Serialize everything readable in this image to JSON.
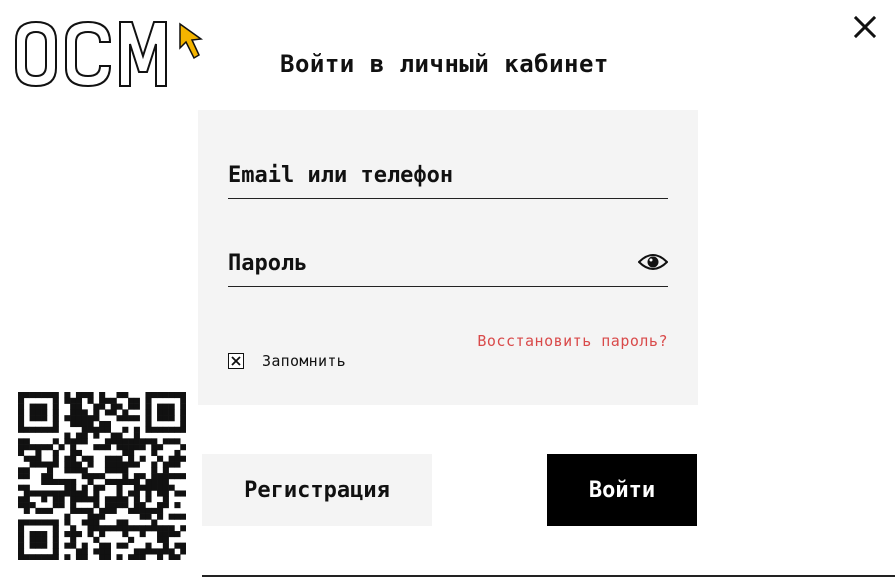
{
  "brand": {
    "logo_text": "ОСМ",
    "accent_color": "#f4b400"
  },
  "dialog": {
    "title": "Войти в личный кабинет",
    "close_icon": "close-icon"
  },
  "form": {
    "email_placeholder": "Email или телефон",
    "password_placeholder": "Пароль",
    "show_password_icon": "eye-icon",
    "restore_link": "Восстановить пароль?",
    "remember_label": "Запомнить",
    "remember_checked": true
  },
  "actions": {
    "register_label": "Регистрация",
    "login_label": "Войти"
  },
  "qr": {
    "icon": "qr-code"
  },
  "colors": {
    "card_bg": "#f4f4f4",
    "link": "#d94a4a",
    "primary_btn": "#000000"
  }
}
